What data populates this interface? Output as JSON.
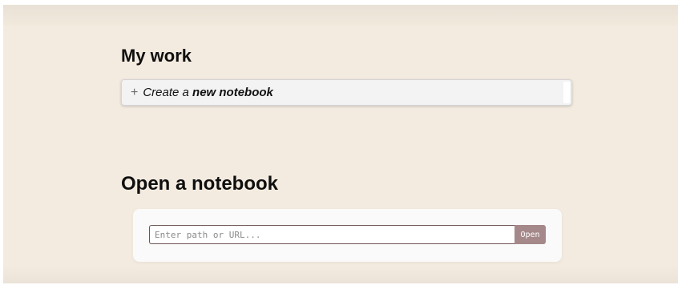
{
  "my_work": {
    "heading": "My work",
    "create_button": {
      "icon": "plus-icon",
      "plus_glyph": "+",
      "prefix": "Create a ",
      "emphasis": "new notebook"
    }
  },
  "open_notebook": {
    "heading": "Open a notebook",
    "path_input": {
      "placeholder": "Enter path or URL...",
      "value": ""
    },
    "open_button_label": "Open"
  },
  "colors": {
    "background": "#f4ebe0",
    "input_border": "#6e5555",
    "open_button": "#a5898a"
  }
}
